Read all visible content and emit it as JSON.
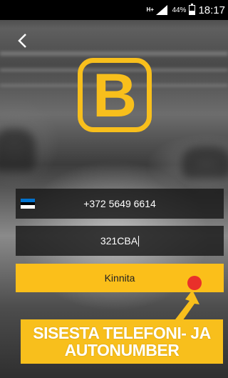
{
  "status_bar": {
    "network": "H+",
    "battery_percent": "44%",
    "battery_level": 0.44,
    "time": "18:17"
  },
  "logo": {
    "letter": "B"
  },
  "phone_field": {
    "country_flag_icon": "estonia-flag-icon",
    "flag_colors": [
      "#0072ce",
      "#000000",
      "#ffffff"
    ],
    "value": "+372 5649 6614"
  },
  "plate_field": {
    "value": "321CBA"
  },
  "confirm_button": {
    "label": "Kinnita"
  },
  "callout": {
    "line1": "SISESTA TELEFONI- JA",
    "line2": "AUTONUMBER"
  },
  "colors": {
    "accent": "#f8bf1c",
    "tap_indicator": "#e9302a"
  }
}
